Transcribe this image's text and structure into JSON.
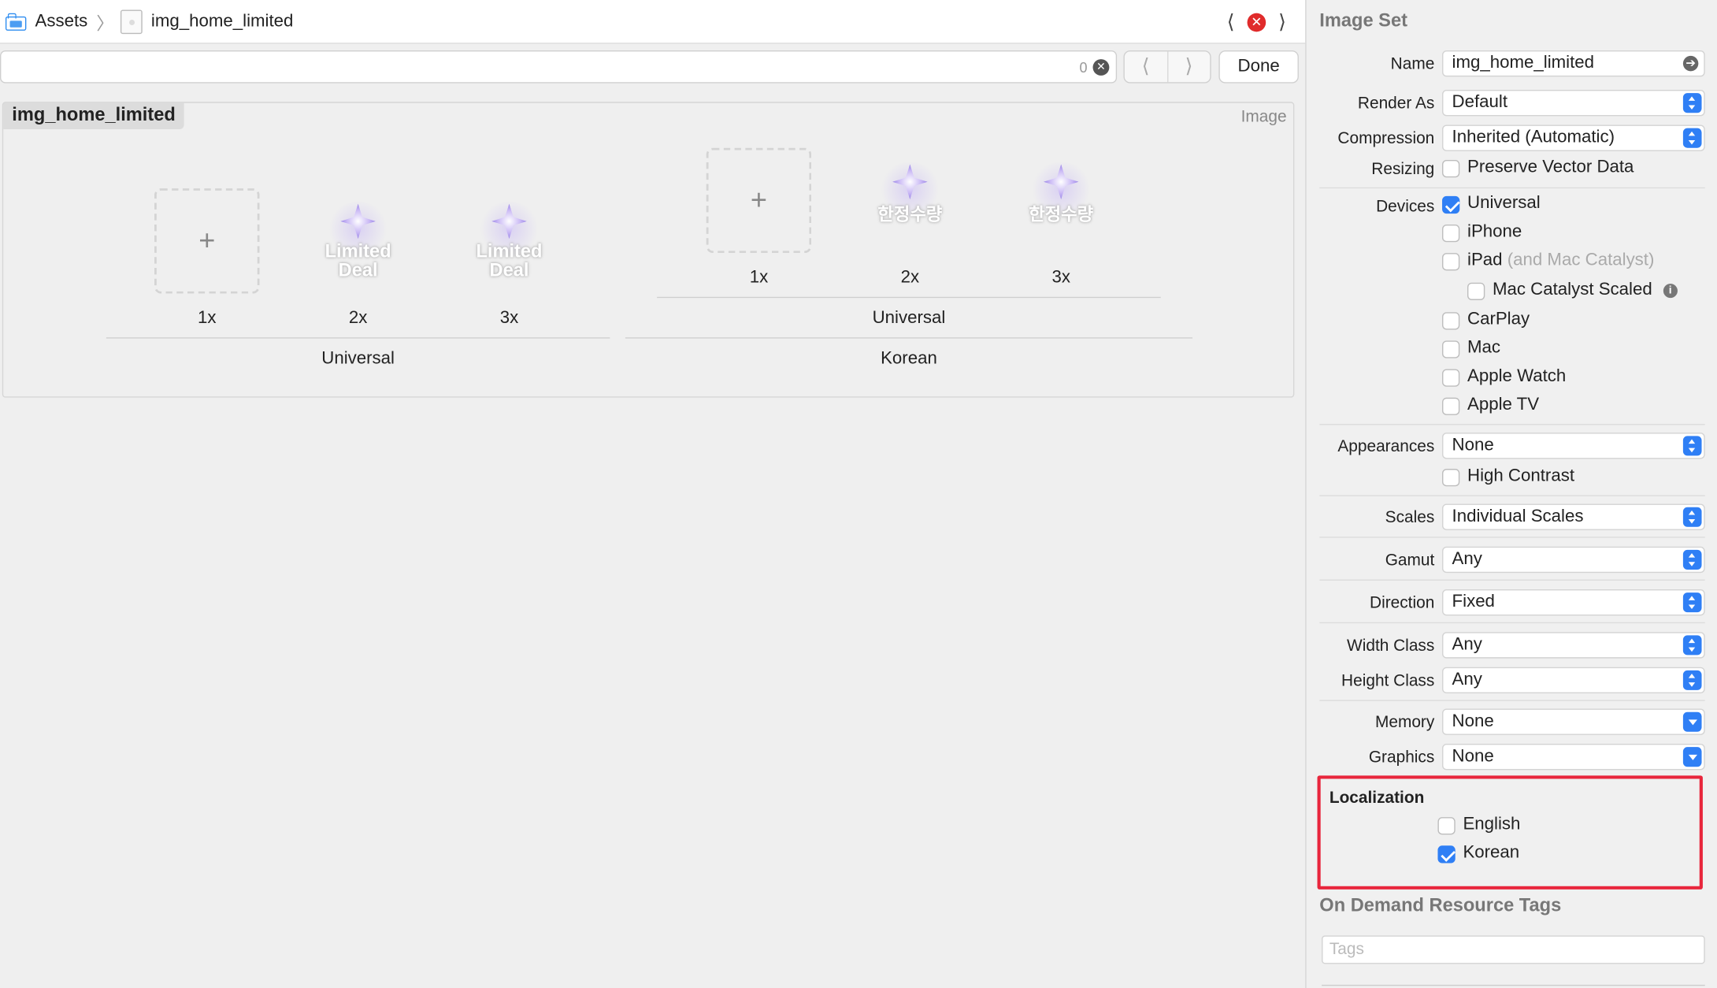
{
  "breadcrumb": {
    "root": "Assets",
    "file": "img_home_limited"
  },
  "find": {
    "count": "0",
    "done_label": "Done"
  },
  "asset": {
    "name": "img_home_limited",
    "kind": "Image",
    "groups": [
      {
        "label": "Universal",
        "slots": [
          {
            "scale": "1x",
            "content": "empty"
          },
          {
            "scale": "2x",
            "content": "Limited Deal"
          },
          {
            "scale": "3x",
            "content": "Limited Deal"
          }
        ]
      },
      {
        "label": "Korean",
        "subgroup": "Universal",
        "slots": [
          {
            "scale": "1x",
            "content": "empty"
          },
          {
            "scale": "2x",
            "content": "한정수량"
          },
          {
            "scale": "3x",
            "content": "한정수량"
          }
        ]
      }
    ],
    "art_text_en_line1": "Limited",
    "art_text_en_line2": "Deal",
    "art_text_ko": "한정수량"
  },
  "inspector": {
    "title": "Image Set",
    "name_label": "Name",
    "name_value": "img_home_limited",
    "render_label": "Render As",
    "render_value": "Default",
    "compression_label": "Compression",
    "compression_value": "Inherited (Automatic)",
    "resizing_label": "Resizing",
    "resizing_option": "Preserve Vector Data",
    "devices_label": "Devices",
    "devices": {
      "universal": "Universal",
      "iphone": "iPhone",
      "ipad": "iPad",
      "ipad_note": "(and Mac Catalyst)",
      "mac_catalyst": "Mac Catalyst Scaled",
      "carplay": "CarPlay",
      "mac": "Mac",
      "watch": "Apple Watch",
      "tv": "Apple TV"
    },
    "appearances_label": "Appearances",
    "appearances_value": "None",
    "high_contrast": "High Contrast",
    "scales_label": "Scales",
    "scales_value": "Individual Scales",
    "gamut_label": "Gamut",
    "gamut_value": "Any",
    "direction_label": "Direction",
    "direction_value": "Fixed",
    "width_label": "Width Class",
    "width_value": "Any",
    "height_label": "Height Class",
    "height_value": "Any",
    "memory_label": "Memory",
    "memory_value": "None",
    "graphics_label": "Graphics",
    "graphics_value": "None",
    "localization_title": "Localization",
    "loc_english": "English",
    "loc_korean": "Korean",
    "odr_title": "On Demand Resource Tags",
    "tags_placeholder": "Tags"
  },
  "colors": {
    "accent": "#2f7ff5",
    "highlight": "#e8263c",
    "error": "#e02b2b"
  }
}
